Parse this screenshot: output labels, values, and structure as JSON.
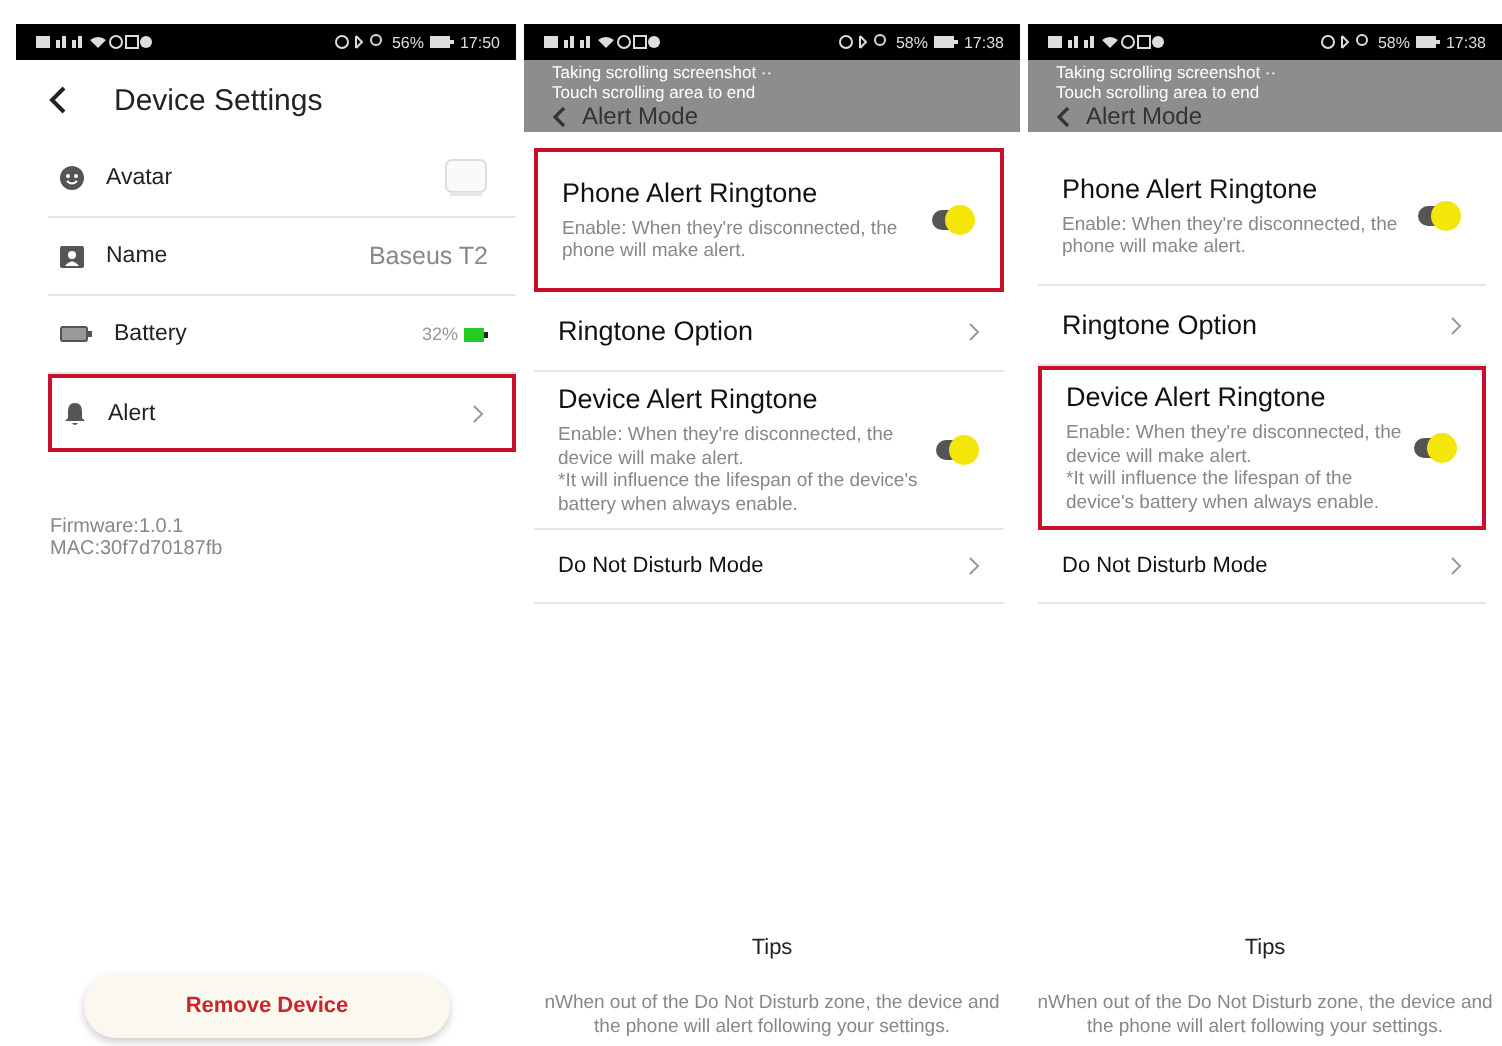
{
  "screens": [
    {
      "kind": "device_settings",
      "status_bar": {
        "battery": "56%",
        "time": "17:50"
      },
      "title": "Device Settings",
      "rows": [
        {
          "kind": "avatar",
          "label": "Avatar",
          "highlighted": false
        },
        {
          "kind": "value",
          "label": "Name",
          "value": "Baseus T2",
          "highlighted": false
        },
        {
          "kind": "battery",
          "label": "Battery",
          "value": "32%",
          "highlighted": false
        },
        {
          "kind": "link",
          "label": "Alert",
          "highlighted": true
        }
      ],
      "firmware": "Firmware:1.0.1",
      "mac": "MAC:30f7d70187fb",
      "button": "Remove Device"
    },
    {
      "kind": "alert_mode",
      "status_bar": {
        "battery": "58%",
        "time": "17:38"
      },
      "title": "Alert Mode",
      "overlay": [
        "Taking scrolling screenshot ··",
        "Touch scrolling area to end"
      ],
      "options": [
        {
          "kind": "toggle",
          "label": "Phone Alert Ringtone",
          "description": [
            "Enable: When they're disconnected, the phone will make alert."
          ],
          "on": true,
          "highlighted": true
        },
        {
          "kind": "link",
          "label": "Ringtone Option",
          "highlighted": false
        },
        {
          "kind": "toggle",
          "label": "Device Alert Ringtone",
          "description": [
            "Enable: When they're disconnected, the device will make alert.",
            "*It will influence the lifespan of the device's battery when always enable."
          ],
          "on": true,
          "highlighted": false
        },
        {
          "kind": "small_link",
          "label": "Do Not Disturb Mode",
          "highlighted": false
        }
      ],
      "tips_title": "Tips",
      "tips": "nWhen out of the Do Not Disturb zone, the device and the phone will alert following your settings."
    },
    {
      "kind": "alert_mode",
      "status_bar": {
        "battery": "58%",
        "time": "17:38"
      },
      "title": "Alert Mode",
      "overlay": [
        "Taking scrolling screenshot ··",
        "Touch scrolling area to end"
      ],
      "options": [
        {
          "kind": "toggle",
          "label": "Phone Alert Ringtone",
          "description": [
            "Enable: When they're disconnected, the phone will make alert."
          ],
          "on": true,
          "highlighted": false
        },
        {
          "kind": "link",
          "label": "Ringtone Option",
          "highlighted": false
        },
        {
          "kind": "toggle",
          "label": "Device Alert Ringtone",
          "description": [
            "Enable: When they're disconnected, the device will make alert.",
            "*It will influence the lifespan of the device's battery when always enable."
          ],
          "on": true,
          "highlighted": true
        },
        {
          "kind": "small_link",
          "label": "Do Not Disturb Mode",
          "highlighted": false
        }
      ],
      "tips_title": "Tips",
      "tips": "nWhen out of the Do Not Disturb zone, the device and the phone will alert following your settings."
    }
  ]
}
